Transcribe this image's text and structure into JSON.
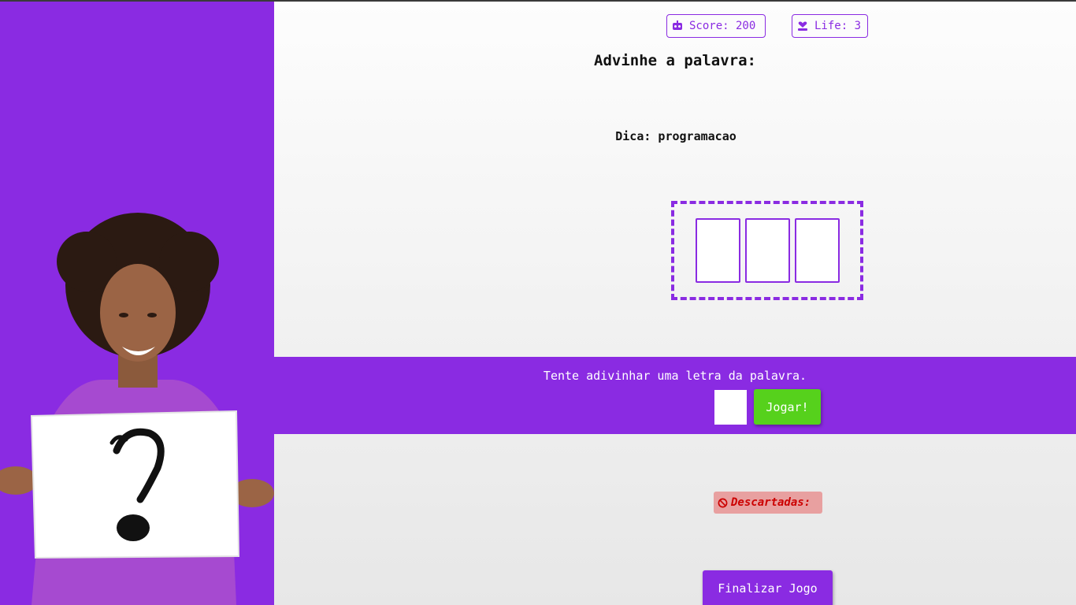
{
  "stats": {
    "score_label": "Score: 200",
    "life_label": "Life: 3"
  },
  "game": {
    "title": "Advinhe a palavra:",
    "hint": "Dica: programacao",
    "slots_count": 3
  },
  "guess": {
    "prompt": "Tente adivinhar uma letra da palavra.",
    "input_value": "",
    "play_label": "Jogar!"
  },
  "discarded": {
    "label": "Descartadas:"
  },
  "actions": {
    "finish_label": "Finalizar Jogo"
  },
  "colors": {
    "accent": "#8a2be2",
    "play_green": "#56d11c",
    "discard_bg": "#e8a0a0",
    "discard_text": "#cc0000"
  },
  "icons": {
    "score": "robot-icon",
    "life": "heart-person-icon",
    "discard": "ban-icon"
  }
}
